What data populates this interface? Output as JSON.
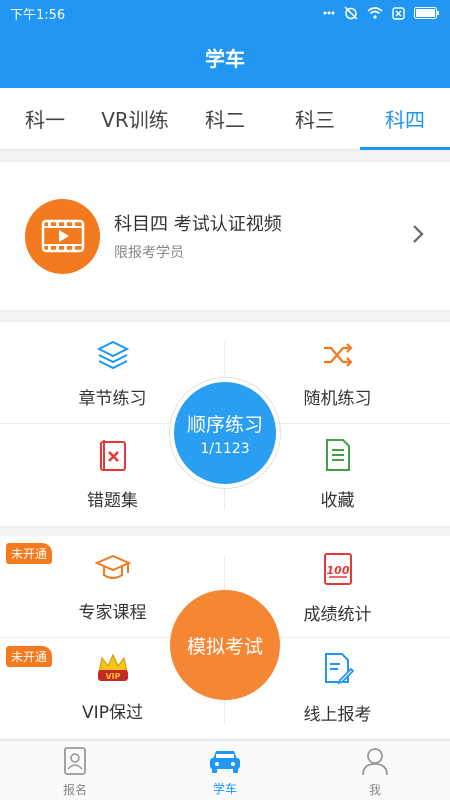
{
  "status_bar": {
    "time": "下午1:56"
  },
  "app_bar": {
    "title": "学车"
  },
  "tabs": [
    {
      "label": "科一"
    },
    {
      "label": "VR训练"
    },
    {
      "label": "科二"
    },
    {
      "label": "科三"
    },
    {
      "label": "科四",
      "active": true
    }
  ],
  "video_card": {
    "title": "科目四 考试认证视频",
    "subtitle": "限报考学员"
  },
  "practice": {
    "chapter": "章节练习",
    "random": "随机练习",
    "wrong": "错题集",
    "favorites": "收藏",
    "sequential_title": "顺序练习",
    "sequential_progress": "1/1123"
  },
  "exam": {
    "badge": "未开通",
    "expert": "专家课程",
    "scores": "成绩统计",
    "vip": "VIP保过",
    "online": "线上报考",
    "mock_title": "模拟考试"
  },
  "bottom_nav": {
    "signup": "报名",
    "learn": "学车",
    "me": "我"
  },
  "colors": {
    "primary": "#2196f3",
    "accent": "#f47a20"
  }
}
